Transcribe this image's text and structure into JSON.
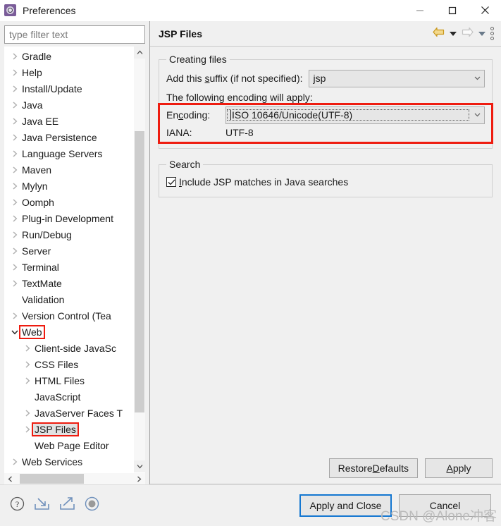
{
  "window": {
    "title": "Preferences",
    "app_icon": "preferences-gear-icon",
    "minimize": "—",
    "maximize": "□",
    "close": "✕"
  },
  "filter": {
    "placeholder": "type filter text",
    "value": ""
  },
  "tree": {
    "items": [
      {
        "label": "Gradle",
        "indent": 0,
        "state": "collapsed",
        "selected": false,
        "boxed": false
      },
      {
        "label": "Help",
        "indent": 0,
        "state": "collapsed",
        "selected": false,
        "boxed": false
      },
      {
        "label": "Install/Update",
        "indent": 0,
        "state": "collapsed",
        "selected": false,
        "boxed": false
      },
      {
        "label": "Java",
        "indent": 0,
        "state": "collapsed",
        "selected": false,
        "boxed": false
      },
      {
        "label": "Java EE",
        "indent": 0,
        "state": "collapsed",
        "selected": false,
        "boxed": false
      },
      {
        "label": "Java Persistence",
        "indent": 0,
        "state": "collapsed",
        "selected": false,
        "boxed": false
      },
      {
        "label": "Language Servers",
        "indent": 0,
        "state": "collapsed",
        "selected": false,
        "boxed": false
      },
      {
        "label": "Maven",
        "indent": 0,
        "state": "collapsed",
        "selected": false,
        "boxed": false
      },
      {
        "label": "Mylyn",
        "indent": 0,
        "state": "collapsed",
        "selected": false,
        "boxed": false
      },
      {
        "label": "Oomph",
        "indent": 0,
        "state": "collapsed",
        "selected": false,
        "boxed": false
      },
      {
        "label": "Plug-in Development",
        "indent": 0,
        "state": "collapsed",
        "selected": false,
        "boxed": false
      },
      {
        "label": "Run/Debug",
        "indent": 0,
        "state": "collapsed",
        "selected": false,
        "boxed": false
      },
      {
        "label": "Server",
        "indent": 0,
        "state": "collapsed",
        "selected": false,
        "boxed": false
      },
      {
        "label": "Terminal",
        "indent": 0,
        "state": "collapsed",
        "selected": false,
        "boxed": false
      },
      {
        "label": "TextMate",
        "indent": 0,
        "state": "collapsed",
        "selected": false,
        "boxed": false
      },
      {
        "label": "Validation",
        "indent": 0,
        "state": "leaf",
        "selected": false,
        "boxed": false
      },
      {
        "label": "Version Control (Tea",
        "indent": 0,
        "state": "collapsed",
        "selected": false,
        "boxed": false
      },
      {
        "label": "Web",
        "indent": 0,
        "state": "expanded",
        "selected": false,
        "boxed": true
      },
      {
        "label": "Client-side JavaSc",
        "indent": 1,
        "state": "collapsed",
        "selected": false,
        "boxed": false
      },
      {
        "label": "CSS Files",
        "indent": 1,
        "state": "collapsed",
        "selected": false,
        "boxed": false
      },
      {
        "label": "HTML Files",
        "indent": 1,
        "state": "collapsed",
        "selected": false,
        "boxed": false
      },
      {
        "label": "JavaScript",
        "indent": 1,
        "state": "leaf",
        "selected": false,
        "boxed": false
      },
      {
        "label": "JavaServer Faces T",
        "indent": 1,
        "state": "collapsed",
        "selected": false,
        "boxed": false
      },
      {
        "label": "JSP Files",
        "indent": 1,
        "state": "collapsed",
        "selected": true,
        "boxed": true
      },
      {
        "label": "Web Page Editor",
        "indent": 1,
        "state": "leaf",
        "selected": false,
        "boxed": false
      },
      {
        "label": "Web Services",
        "indent": 0,
        "state": "collapsed",
        "selected": false,
        "boxed": false
      }
    ],
    "scroll_up_icon": "chevron-up-icon",
    "scroll_down_icon": "chevron-down-icon",
    "scroll_left_icon": "chevron-left-icon",
    "scroll_right_icon": "chevron-right-icon"
  },
  "page": {
    "title": "JSP Files",
    "back_icon": "back-arrow-icon",
    "forward_icon": "forward-arrow-icon",
    "menu_icon": "view-menu-icon",
    "creating_files": {
      "legend": "Creating files",
      "suffix_label_pre": "Add this ",
      "suffix_label_mnemonic": "s",
      "suffix_label_post": "uffix (if not specified):",
      "suffix_value": "jsp",
      "encoding_note": "The following encoding will apply:",
      "encoding_label_pre": "En",
      "encoding_label_mnemonic": "c",
      "encoding_label_post": "oding:",
      "encoding_value": "ISO 10646/Unicode(UTF-8)",
      "iana_label": "IANA:",
      "iana_value": "UTF-8"
    },
    "search": {
      "legend": "Search",
      "checkbox_checked": true,
      "checkbox_label_pre": "",
      "checkbox_label_mnemonic": "I",
      "checkbox_label_post": "nclude JSP matches in Java searches"
    },
    "restore_defaults_pre": "Restore ",
    "restore_defaults_mnemonic": "D",
    "restore_defaults_post": "efaults",
    "apply_mnemonic": "A",
    "apply_post": "pply"
  },
  "dialog": {
    "help_icon": "help-icon",
    "import_icon": "import-icon",
    "export_icon": "export-icon",
    "record_icon": "record-icon",
    "apply_and_close": "Apply and Close",
    "cancel": "Cancel"
  },
  "watermark": "CSDN @Alone冲客",
  "colors": {
    "annotation_red": "#ee1c10",
    "default_button_blue": "#1477d1",
    "back_arrow_gold": "#d8a21a",
    "forward_arrow_gray": "#bdbdbd",
    "selection_gray": "#e2e2e2"
  }
}
